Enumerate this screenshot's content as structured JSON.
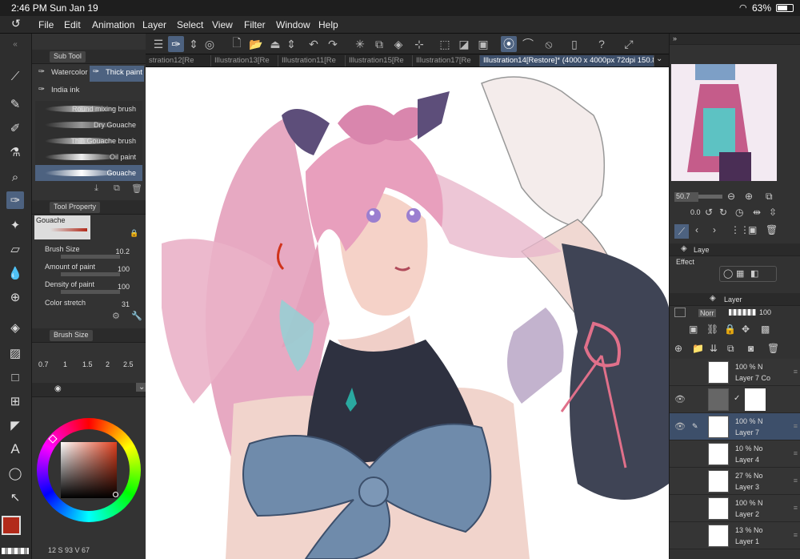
{
  "statusbar": {
    "time": "2:46 PM",
    "date": "Sun Jan 19",
    "battery": "63%"
  },
  "menu": [
    "File",
    "Edit",
    "Animation",
    "Layer",
    "Select",
    "View",
    "Filter",
    "Window",
    "Help"
  ],
  "subtool": {
    "title": "Sub Tool",
    "groups": [
      "Watercolor",
      "Thick paint",
      "India ink"
    ],
    "brushes": [
      "Round mixing brush",
      "Dry Gouache",
      "Thin Gouache brush",
      "Oil paint",
      "Gouache"
    ]
  },
  "toolprop": {
    "title": "Tool Property",
    "preset": "Gouache",
    "rows": [
      {
        "label": "Brush Size",
        "value": "10.2"
      },
      {
        "label": "Amount of paint",
        "value": "100"
      },
      {
        "label": "Density of paint",
        "value": "100"
      },
      {
        "label": "Color stretch",
        "value": "31"
      }
    ]
  },
  "brushsize": {
    "title": "Brush Size",
    "values": [
      "0.7",
      "1",
      "1.5",
      "2",
      "2.5"
    ]
  },
  "bottombar": {
    "text": "12 S 93 V 67"
  },
  "tabs": [
    "stration12[Re",
    "Illustration13[Re",
    "Illustration11[Re",
    "Illustration15[Re",
    "Illustration17[Re",
    "Illustration14[Restore]* (4000 x 4000px 72dpi 150.8%)"
  ],
  "navigator": {
    "zoom": "50.7",
    "rotation": "0.0"
  },
  "palette": {
    "tab_label": "Laye",
    "effect_label": "Effect"
  },
  "layerpanel": {
    "tab_label": "Layer",
    "blend": "Norr",
    "opacity": "100",
    "layers": [
      {
        "opacity": "100 % N",
        "name": "Layer 7 Co"
      },
      {
        "opacity": "",
        "name": ""
      },
      {
        "opacity": "100 % N",
        "name": "Layer 7"
      },
      {
        "opacity": "10 % No",
        "name": "Layer 4"
      },
      {
        "opacity": "27 % No",
        "name": "Layer 3"
      },
      {
        "opacity": "100 % N",
        "name": "Layer 2"
      },
      {
        "opacity": "13 % No",
        "name": "Layer 1"
      }
    ]
  },
  "colors": {
    "accent": "#4d6280",
    "main_color": "#b22a1a",
    "sub_color": "#7a1e1e"
  }
}
